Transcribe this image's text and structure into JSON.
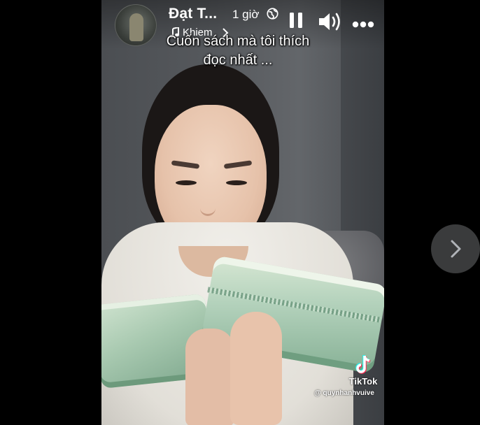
{
  "post": {
    "author": "Đạt T...",
    "time": "1 giờ",
    "privacy_icon": "globe-icon",
    "music_text": "Khiem"
  },
  "video": {
    "caption_line1": "Cuốn sách mà tôi thích",
    "caption_line2": "đọc nhất ...",
    "watermark_brand": "TikTok",
    "watermark_handle": "@ quynhanhvuive"
  },
  "controls": {
    "pause_icon": "pause-icon",
    "volume_icon": "volume-icon",
    "more_icon": "more-icon",
    "next_icon": "chevron-right-icon"
  },
  "colors": {
    "background": "#000000",
    "text": "#ffffff",
    "next_button_bg": "#3a3b3c"
  }
}
